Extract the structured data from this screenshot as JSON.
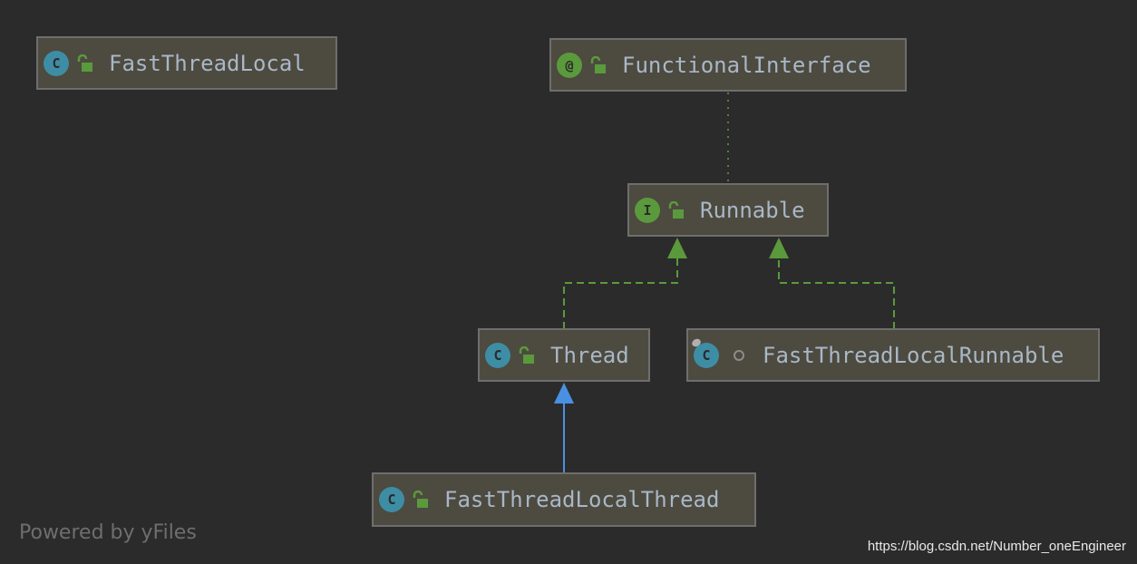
{
  "nodes": [
    {
      "id": "fast-thread-local",
      "label": "FastThreadLocal",
      "kind": "class",
      "badge": "C",
      "access": "public"
    },
    {
      "id": "functional-interface",
      "label": "FunctionalInterface",
      "kind": "annotation",
      "badge": "@",
      "access": "public"
    },
    {
      "id": "runnable",
      "label": "Runnable",
      "kind": "interface",
      "badge": "I",
      "access": "public"
    },
    {
      "id": "thread",
      "label": "Thread",
      "kind": "class",
      "badge": "C",
      "access": "public"
    },
    {
      "id": "fast-thread-local-runnable",
      "label": "FastThreadLocalRunnable",
      "kind": "final-class",
      "badge": "C",
      "access": "package-private"
    },
    {
      "id": "fast-thread-local-thread",
      "label": "FastThreadLocalThread",
      "kind": "class",
      "badge": "C",
      "access": "public"
    }
  ],
  "edges": [
    {
      "from": "runnable",
      "to": "functional-interface",
      "type": "annotation",
      "style": "dotted",
      "color": "#5a7d3c"
    },
    {
      "from": "thread",
      "to": "runnable",
      "type": "implements",
      "style": "dashed",
      "color": "#5a9a3c"
    },
    {
      "from": "fast-thread-local-runnable",
      "to": "runnable",
      "type": "implements",
      "style": "dashed",
      "color": "#5a9a3c"
    },
    {
      "from": "fast-thread-local-thread",
      "to": "thread",
      "type": "extends",
      "style": "solid",
      "color": "#4a90e2"
    }
  ],
  "footer": {
    "powered_by": "Powered by yFiles",
    "watermark": "https://blog.csdn.net/Number_oneEngineer"
  },
  "colors": {
    "background": "#2b2b2b",
    "node": "#4d4a40",
    "text": "#a9b7c6",
    "class_badge": "#3d8ea5",
    "interface_badge": "#5a9a3c"
  }
}
